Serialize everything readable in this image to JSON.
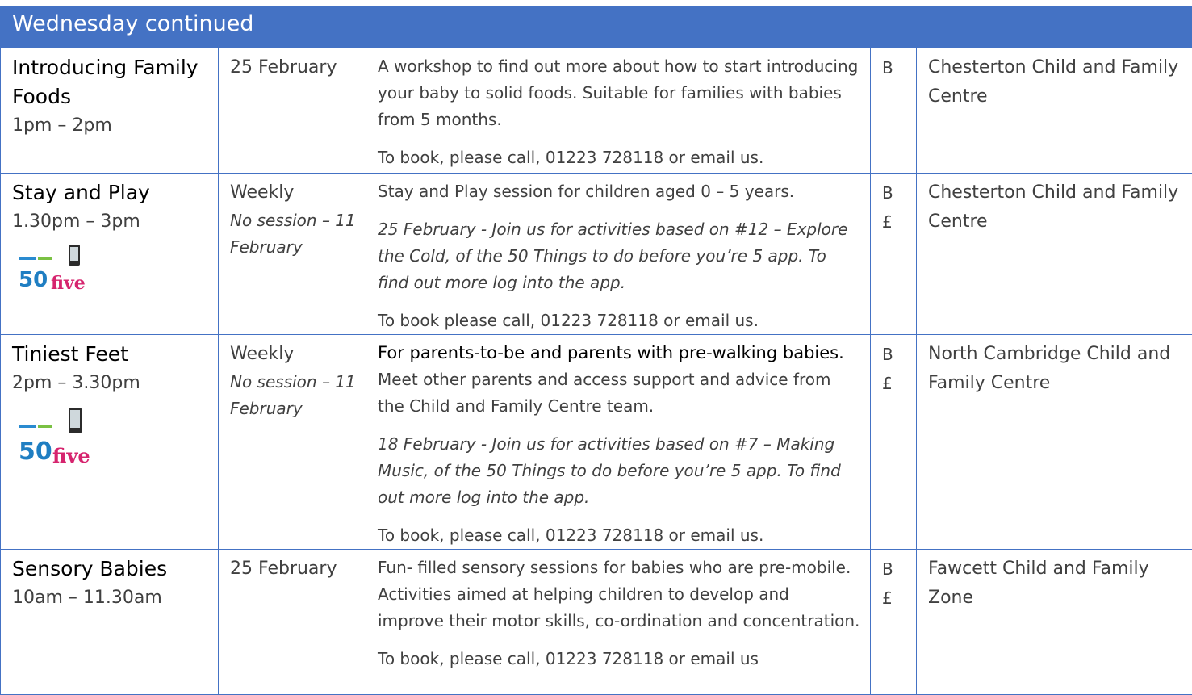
{
  "header": {
    "title": "Wednesday continued"
  },
  "rows": [
    {
      "title": "Introducing Family Foods",
      "time": "1pm – 2pm",
      "date": "25 February",
      "date_note": "",
      "desc1": "A workshop to find out more about how to start introducing your baby to solid foods. Suitable for families with babies from 5 months.",
      "desc_italic": "",
      "booking": "To book, please call, 01223 728118 or email us.",
      "codes": "B",
      "location": "Chesterton Child and Family Centre"
    },
    {
      "title": "Stay and Play",
      "time": "1.30pm – 3pm",
      "date": "Weekly",
      "date_note": "No session – 11 February",
      "desc1": "Stay and Play session for children aged 0 – 5 years.",
      "desc_italic": "25 February - Join us for activities based on #12 – Explore the Cold, of the 50 Things to do before you’re 5 app. To find out more log into the app.",
      "booking": "To book please call, 01223 728118 or email us.",
      "codes": "B\n£",
      "location": "Chesterton Child and Family Centre"
    },
    {
      "title": "Tiniest Feet",
      "time": "2pm – 3.30pm",
      "date": "Weekly",
      "date_note": "No session – 11 February",
      "desc_strong": "For parents-to-be and parents with pre-walking babies.",
      "desc1": "Meet other parents and access support and advice from the Child and Family Centre team.",
      "desc_italic": "18 February - Join us for activities based on #7 – Making Music, of the 50 Things to do before you’re 5 app. To find out more log into the app.",
      "booking": "To book, please call, 01223 728118 or email us.",
      "codes": "B\n£",
      "location": "North Cambridge Child and Family Centre"
    },
    {
      "title": "Sensory Babies",
      "time": "10am – 11.30am",
      "date": "25 February",
      "date_note": "",
      "desc1": "Fun- filled sensory sessions for babies who are pre-mobile. Activities aimed at helping children to develop and improve their motor skills, co-ordination and concentration.",
      "desc_italic": "",
      "booking": "To book, please call, 01223 728118 or email us",
      "codes": "B\n£",
      "location": "Fawcett Child and Family Zone"
    }
  ],
  "logo": {
    "number": "50",
    "word": "five",
    "accent": "#d6246e",
    "number_color": "#1f7ec2"
  }
}
